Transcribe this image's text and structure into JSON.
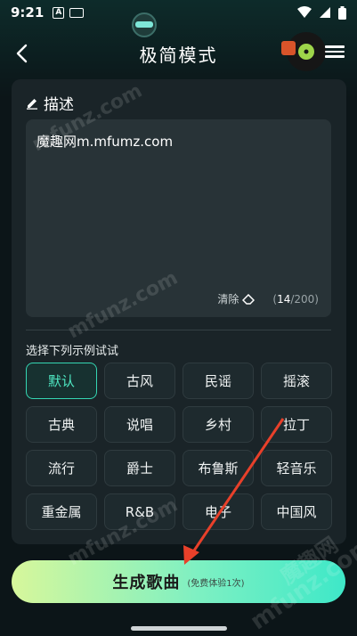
{
  "status_bar": {
    "time": "9:21",
    "notification_icons": [
      "A-icon",
      "keyboard-icon"
    ],
    "right_icons": [
      "wifi-icon",
      "signal-icon",
      "battery-icon"
    ]
  },
  "header": {
    "title": "极简模式",
    "back_icon": "chevron-left-icon",
    "menu_icon": "hamburger-menu-icon"
  },
  "description": {
    "heading": "描述",
    "heading_icon": "pencil-icon",
    "value": "魔趣网m.mfumz.com",
    "clear_label": "清除",
    "clear_icon": "eraser-icon",
    "counter_open": "(",
    "counter_current": "14",
    "counter_sep_max": "/200)"
  },
  "examples": {
    "label": "选择下列示例试试",
    "items": [
      {
        "label": "默认",
        "selected": true
      },
      {
        "label": "古风",
        "selected": false
      },
      {
        "label": "民谣",
        "selected": false
      },
      {
        "label": "摇滚",
        "selected": false
      },
      {
        "label": "古典",
        "selected": false
      },
      {
        "label": "说唱",
        "selected": false
      },
      {
        "label": "乡村",
        "selected": false
      },
      {
        "label": "拉丁",
        "selected": false
      },
      {
        "label": "流行",
        "selected": false
      },
      {
        "label": "爵士",
        "selected": false
      },
      {
        "label": "布鲁斯",
        "selected": false
      },
      {
        "label": "轻音乐",
        "selected": false
      },
      {
        "label": "重金属",
        "selected": false
      },
      {
        "label": "R&B",
        "selected": false
      },
      {
        "label": "电子",
        "selected": false
      },
      {
        "label": "中国风",
        "selected": false
      }
    ]
  },
  "generate": {
    "label": "生成歌曲",
    "sub_label": "(免费体验1次)"
  },
  "watermarks": [
    "mfunz.com",
    "mfunz.com",
    "mfunz.com",
    "mfunz.com",
    "魔趣网"
  ],
  "colors": {
    "accent": "#35d6b3",
    "arrow": "#e8402a",
    "background": "#0c1518",
    "card": "#1a2428"
  }
}
